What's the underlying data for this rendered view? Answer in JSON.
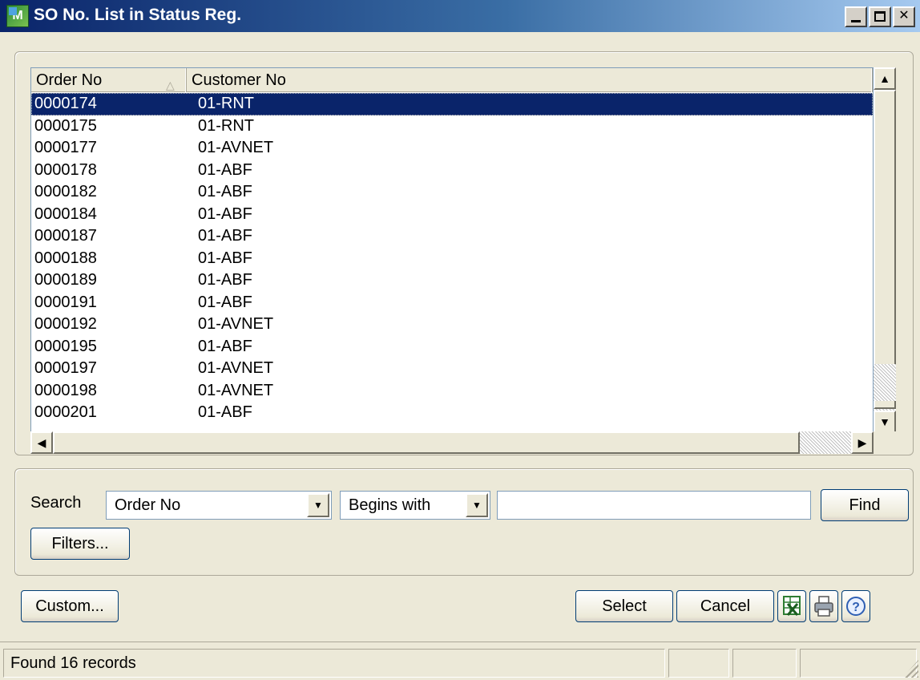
{
  "window": {
    "title": "SO No. List in Status Reg."
  },
  "list": {
    "columns": [
      {
        "label": "Order No"
      },
      {
        "label": "Customer No"
      }
    ],
    "rows": [
      {
        "order_no": "0000174",
        "customer_no": "01-RNT"
      },
      {
        "order_no": "0000175",
        "customer_no": "01-RNT"
      },
      {
        "order_no": "0000177",
        "customer_no": "01-AVNET"
      },
      {
        "order_no": "0000178",
        "customer_no": "01-ABF"
      },
      {
        "order_no": "0000182",
        "customer_no": "01-ABF"
      },
      {
        "order_no": "0000184",
        "customer_no": "01-ABF"
      },
      {
        "order_no": "0000187",
        "customer_no": "01-ABF"
      },
      {
        "order_no": "0000188",
        "customer_no": "01-ABF"
      },
      {
        "order_no": "0000189",
        "customer_no": "01-ABF"
      },
      {
        "order_no": "0000191",
        "customer_no": "01-ABF"
      },
      {
        "order_no": "0000192",
        "customer_no": "01-AVNET"
      },
      {
        "order_no": "0000195",
        "customer_no": "01-ABF"
      },
      {
        "order_no": "0000197",
        "customer_no": "01-AVNET"
      },
      {
        "order_no": "0000198",
        "customer_no": "01-AVNET"
      },
      {
        "order_no": "0000201",
        "customer_no": "01-ABF"
      }
    ],
    "selected_row": 0
  },
  "search": {
    "label": "Search",
    "field_value": "Order No",
    "operator_value": "Begins with",
    "text_value": "",
    "find_label": "Find",
    "filters_label": "Filters..."
  },
  "buttons": {
    "custom_label": "Custom...",
    "select_label": "Select",
    "cancel_label": "Cancel"
  },
  "status": {
    "text": "Found 16 records"
  },
  "colors": {
    "title_start": "#0a246a",
    "title_end": "#a6caf0",
    "selection": "#0a246a",
    "face": "#ece9d8"
  },
  "icons": [
    "app-icon",
    "minimize-icon",
    "maximize-icon",
    "close-icon",
    "sort-ascending-icon",
    "excel-icon",
    "print-icon",
    "help-icon",
    "size-grip-icon"
  ]
}
